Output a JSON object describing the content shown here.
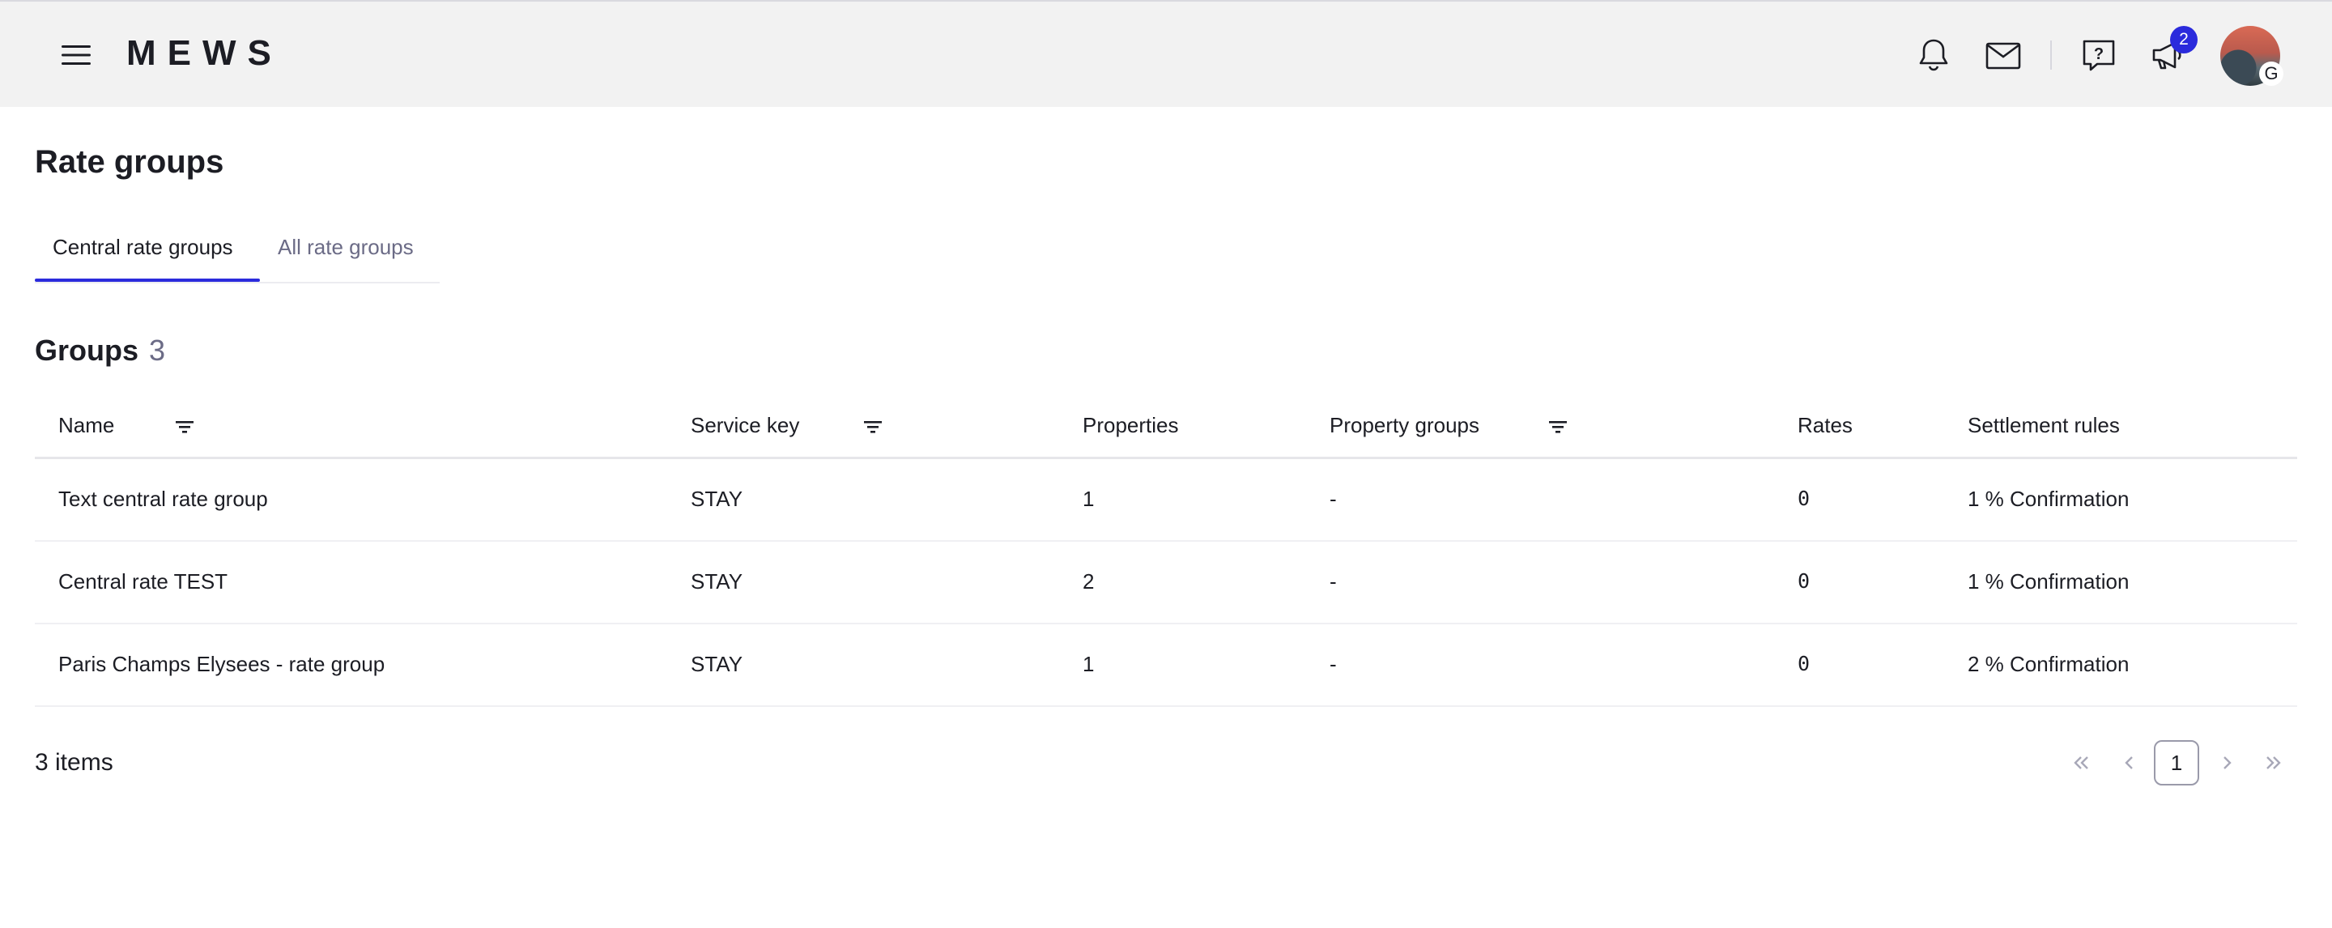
{
  "header": {
    "logo_text": "MEWS",
    "notification_count": "2",
    "avatar_initial": "G"
  },
  "page": {
    "title": "Rate groups"
  },
  "tabs": [
    {
      "label": "Central rate groups",
      "active": true
    },
    {
      "label": "All rate groups",
      "active": false
    }
  ],
  "groups": {
    "title": "Groups",
    "count": "3"
  },
  "table": {
    "columns": [
      "Name",
      "Service key",
      "Properties",
      "Property groups",
      "Rates",
      "Settlement rules"
    ],
    "rows": [
      {
        "name": "Text central rate group",
        "service_key": "STAY",
        "properties": "1",
        "property_groups": "-",
        "rates": "0",
        "settlement_rules": "1 % Confirmation"
      },
      {
        "name": "Central rate TEST",
        "service_key": "STAY",
        "properties": "2",
        "property_groups": "-",
        "rates": "0",
        "settlement_rules": "1 % Confirmation"
      },
      {
        "name": "Paris Champs Elysees - rate group",
        "service_key": "STAY",
        "properties": "1",
        "property_groups": "-",
        "rates": "0",
        "settlement_rules": "2 % Confirmation"
      }
    ]
  },
  "footer": {
    "items_label": "3 items",
    "current_page": "1"
  },
  "colors": {
    "accent": "#2b2bdc",
    "header_bg": "#f2f2f2",
    "muted_text": "#6b6b86"
  },
  "icons": [
    "hamburger-menu-icon",
    "bell-icon",
    "mail-icon",
    "help-icon",
    "megaphone-icon",
    "filter-icon",
    "first-page-icon",
    "prev-page-icon",
    "next-page-icon",
    "last-page-icon"
  ]
}
